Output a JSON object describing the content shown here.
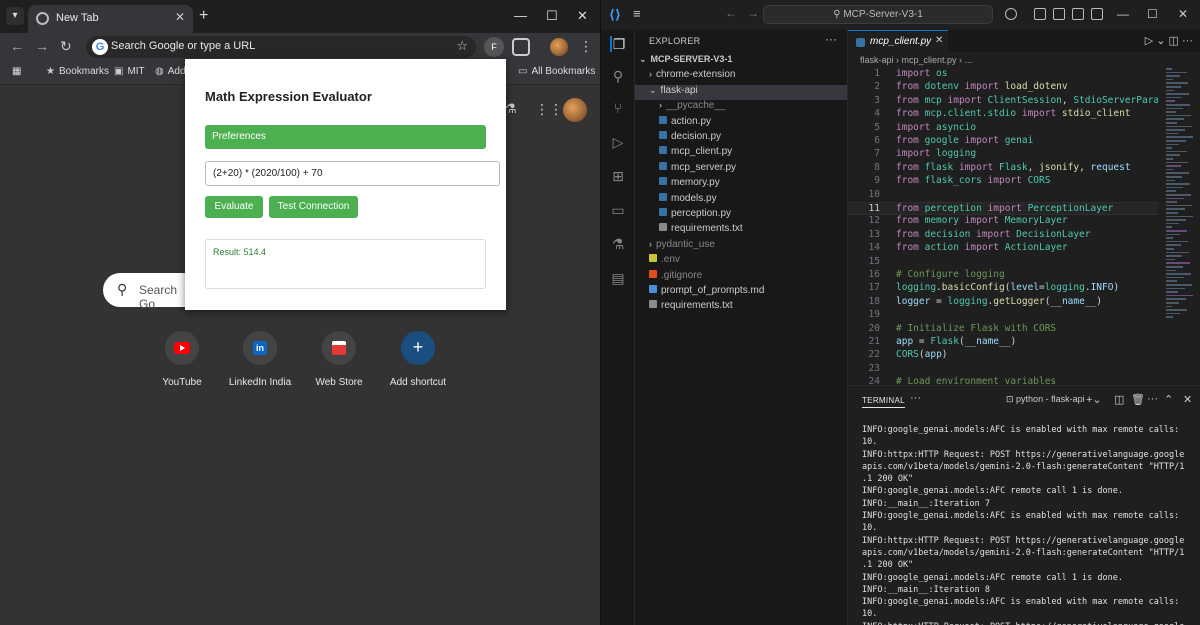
{
  "chrome": {
    "tab_title": "New Tab",
    "new_tab": "+",
    "omnibox_placeholder": "Search Google or type a URL",
    "profile_initial": "F",
    "bookmarks": [
      {
        "label": "Bookmarks"
      },
      {
        "label": "MIT"
      },
      {
        "label": "Add"
      }
    ],
    "all_bookmarks": "All Bookmarks",
    "ntp_search_placeholder": "Search Go",
    "shortcuts": [
      {
        "label": "YouTube"
      },
      {
        "label": "LinkedIn India"
      },
      {
        "label": "Web Store"
      },
      {
        "label": "Add shortcut"
      }
    ]
  },
  "popup": {
    "title": "Math Expression Evaluator",
    "preferences_label": "Preferences",
    "expression_value": "(2+20) * (2020/100) + 70",
    "evaluate_label": "Evaluate",
    "test_label": "Test Connection",
    "result_text": "Result: 514.4",
    "accent_color": "#4caf50"
  },
  "vscode": {
    "command_center": "MCP-Server-V3-1",
    "explorer_title": "EXPLORER",
    "tree": [
      {
        "label": "MCP-SERVER-V3-1",
        "level": 0,
        "type": "root"
      },
      {
        "label": "chrome-extension",
        "level": 1,
        "type": "folder-closed"
      },
      {
        "label": "flask-api",
        "level": 1,
        "type": "folder-open"
      },
      {
        "label": "__pycache__",
        "level": 2,
        "type": "folder-closed"
      },
      {
        "label": "action.py",
        "level": 2,
        "type": "py"
      },
      {
        "label": "decision.py",
        "level": 2,
        "type": "py"
      },
      {
        "label": "mcp_client.py",
        "level": 2,
        "type": "py"
      },
      {
        "label": "mcp_server.py",
        "level": 2,
        "type": "py"
      },
      {
        "label": "memory.py",
        "level": 2,
        "type": "py"
      },
      {
        "label": "models.py",
        "level": 2,
        "type": "py"
      },
      {
        "label": "perception.py",
        "level": 2,
        "type": "py"
      },
      {
        "label": "requirements.txt",
        "level": 2,
        "type": "txt"
      },
      {
        "label": "pydantic_use",
        "level": 1,
        "type": "folder-closed"
      },
      {
        "label": ".env",
        "level": 1,
        "type": "env"
      },
      {
        "label": ".gitignore",
        "level": 1,
        "type": "git"
      },
      {
        "label": "prompt_of_prompts.md",
        "level": 1,
        "type": "md"
      },
      {
        "label": "requirements.txt",
        "level": 1,
        "type": "txt"
      }
    ],
    "editor_tab": "mcp_client.py",
    "breadcrumb": "flask-api  ›  mcp_client.py  ›  ...",
    "code_lines": [
      {
        "n": "1",
        "parts": [
          [
            "kw",
            "import "
          ],
          [
            "mod",
            "os"
          ]
        ]
      },
      {
        "n": "2",
        "parts": [
          [
            "kw",
            "from "
          ],
          [
            "mod",
            "dotenv "
          ],
          [
            "kw",
            "import "
          ],
          [
            "fn",
            "load_dotenv"
          ]
        ]
      },
      {
        "n": "3",
        "parts": [
          [
            "kw",
            "from "
          ],
          [
            "mod",
            "mcp "
          ],
          [
            "kw",
            "import "
          ],
          [
            "mod",
            "ClientSession"
          ],
          [
            "tx",
            ", "
          ],
          [
            "mod",
            "StdioServerParameter"
          ]
        ]
      },
      {
        "n": "4",
        "parts": [
          [
            "kw",
            "from "
          ],
          [
            "mod",
            "mcp.client.stdio "
          ],
          [
            "kw",
            "import "
          ],
          [
            "fn",
            "stdio_client"
          ]
        ]
      },
      {
        "n": "5",
        "parts": [
          [
            "kw",
            "import "
          ],
          [
            "mod",
            "asyncio"
          ]
        ]
      },
      {
        "n": "6",
        "parts": [
          [
            "kw",
            "from "
          ],
          [
            "mod",
            "google "
          ],
          [
            "kw",
            "import "
          ],
          [
            "mod",
            "genai"
          ]
        ]
      },
      {
        "n": "7",
        "parts": [
          [
            "kw",
            "import "
          ],
          [
            "mod",
            "logging"
          ]
        ]
      },
      {
        "n": "8",
        "parts": [
          [
            "kw",
            "from "
          ],
          [
            "mod",
            "flask "
          ],
          [
            "kw",
            "import "
          ],
          [
            "mod",
            "Flask"
          ],
          [
            "tx",
            ", "
          ],
          [
            "fn",
            "jsonify"
          ],
          [
            "tx",
            ", "
          ],
          [
            "var",
            "request"
          ]
        ]
      },
      {
        "n": "9",
        "parts": [
          [
            "kw",
            "from "
          ],
          [
            "mod",
            "flask_cors "
          ],
          [
            "kw",
            "import "
          ],
          [
            "mod",
            "CORS"
          ]
        ]
      },
      {
        "n": "10",
        "parts": []
      },
      {
        "n": "11",
        "parts": [
          [
            "kw",
            "from "
          ],
          [
            "mod",
            "perception "
          ],
          [
            "kw",
            "import "
          ],
          [
            "mod",
            "PerceptionLayer"
          ]
        ]
      },
      {
        "n": "12",
        "parts": [
          [
            "kw",
            "from "
          ],
          [
            "mod",
            "memory "
          ],
          [
            "kw",
            "import "
          ],
          [
            "mod",
            "MemoryLayer"
          ]
        ]
      },
      {
        "n": "13",
        "parts": [
          [
            "kw",
            "from "
          ],
          [
            "mod",
            "decision "
          ],
          [
            "kw",
            "import "
          ],
          [
            "mod",
            "DecisionLayer"
          ]
        ]
      },
      {
        "n": "14",
        "parts": [
          [
            "kw",
            "from "
          ],
          [
            "mod",
            "action "
          ],
          [
            "kw",
            "import "
          ],
          [
            "mod",
            "ActionLayer"
          ]
        ]
      },
      {
        "n": "15",
        "parts": []
      },
      {
        "n": "16",
        "parts": [
          [
            "cm",
            "# Configure logging"
          ]
        ]
      },
      {
        "n": "17",
        "parts": [
          [
            "mod",
            "logging"
          ],
          [
            "tx",
            "."
          ],
          [
            "fn",
            "basicConfig"
          ],
          [
            "tx",
            "("
          ],
          [
            "var",
            "level"
          ],
          [
            "tx",
            "="
          ],
          [
            "mod",
            "logging"
          ],
          [
            "tx",
            "."
          ],
          [
            "var",
            "INFO"
          ],
          [
            "tx",
            ")"
          ]
        ]
      },
      {
        "n": "18",
        "parts": [
          [
            "var",
            "logger "
          ],
          [
            "tx",
            "= "
          ],
          [
            "mod",
            "logging"
          ],
          [
            "tx",
            "."
          ],
          [
            "fn",
            "getLogger"
          ],
          [
            "tx",
            "("
          ],
          [
            "var",
            "__name__"
          ],
          [
            "tx",
            ")"
          ]
        ]
      },
      {
        "n": "19",
        "parts": []
      },
      {
        "n": "20",
        "parts": [
          [
            "cm",
            "# Initialize Flask with CORS"
          ]
        ]
      },
      {
        "n": "21",
        "parts": [
          [
            "var",
            "app "
          ],
          [
            "tx",
            "= "
          ],
          [
            "mod",
            "Flask"
          ],
          [
            "tx",
            "("
          ],
          [
            "var",
            "__name__"
          ],
          [
            "tx",
            ")"
          ]
        ]
      },
      {
        "n": "22",
        "parts": [
          [
            "mod",
            "CORS"
          ],
          [
            "tx",
            "("
          ],
          [
            "var",
            "app"
          ],
          [
            "tx",
            ")"
          ]
        ]
      },
      {
        "n": "23",
        "parts": []
      },
      {
        "n": "24",
        "parts": [
          [
            "cm",
            "# Load environment variables"
          ]
        ]
      }
    ],
    "active_line": "11",
    "terminal_tab": "TERMINAL",
    "terminal_shell": "python - flask-api",
    "terminal_lines": [
      "INFO:google_genai.models:AFC is enabled with max remote calls:",
      "10.",
      "INFO:httpx:HTTP Request: POST https://generativelanguage.google",
      "apis.com/v1beta/models/gemini-2.0-flash:generateContent \"HTTP/1",
      ".1 200 OK\"",
      "INFO:google_genai.models:AFC remote call 1 is done.",
      "INFO:__main__:Iteration 7",
      "INFO:google_genai.models:AFC is enabled with max remote calls:",
      "10.",
      "INFO:httpx:HTTP Request: POST https://generativelanguage.google",
      "apis.com/v1beta/models/gemini-2.0-flash:generateContent \"HTTP/1",
      ".1 200 OK\"",
      "INFO:google_genai.models:AFC remote call 1 is done.",
      "INFO:__main__:Iteration 8",
      "INFO:google_genai.models:AFC is enabled with max remote calls:",
      "10.",
      "INFO:httpx:HTTP Request: POST https://generativelanguage.google"
    ]
  }
}
